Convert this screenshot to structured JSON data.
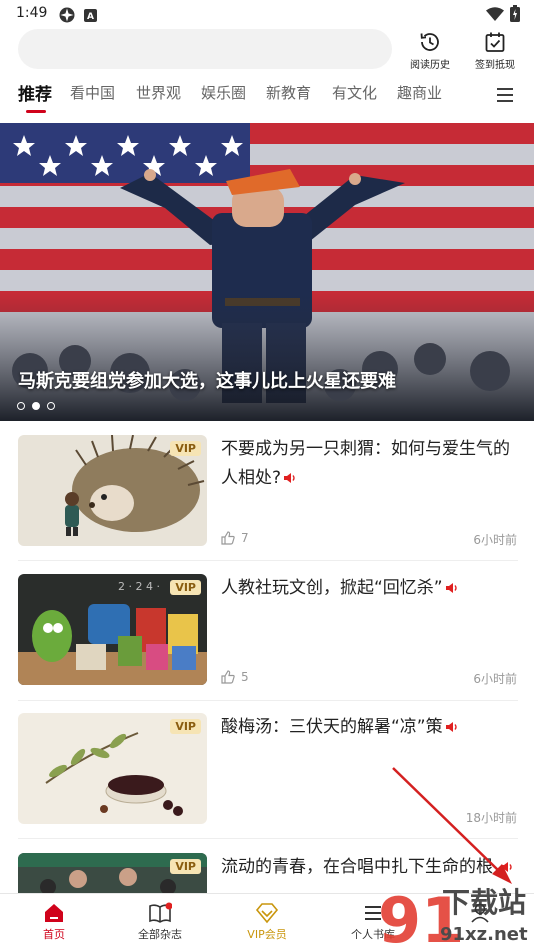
{
  "status_bar": {
    "time": "1:49"
  },
  "header": {
    "search_placeholder": "",
    "history_label": "阅读历史",
    "checkin_label": "签到抵现"
  },
  "tabs": [
    "推荐",
    "看中国",
    "世界观",
    "娱乐圈",
    "新教育",
    "有文化",
    "趣商业"
  ],
  "hero": {
    "title": "马斯克要组党参加大选，这事儿比上火星还要难",
    "slide_count": 3,
    "active_slide": 2
  },
  "articles": [
    {
      "title": "不要成为另一只刺猬：如何与爱生气的人相处?",
      "vip": "VIP",
      "likes": "7",
      "time": "6小时前"
    },
    {
      "title": "人教社玩文创，掀起“回忆杀”",
      "vip": "VIP",
      "likes": "5",
      "time": "6小时前"
    },
    {
      "title": "酸梅汤：三伏天的解暑“凉”策",
      "vip": "VIP",
      "likes": "",
      "time": "18小时前"
    },
    {
      "title": "流动的青春，在合唱中扎下生命的根",
      "vip": "VIP",
      "likes": "",
      "time": ""
    }
  ],
  "bottom_nav": [
    {
      "label": "首页"
    },
    {
      "label": "全部杂志"
    },
    {
      "label": "VIP会员"
    },
    {
      "label": "个人书库"
    },
    {
      "label": ""
    }
  ],
  "watermark": {
    "logo": "91",
    "text_top": "下载站",
    "text_bottom": "91xz.net"
  },
  "colors": {
    "accent": "#d0021b",
    "vip_gold": "#c9960d",
    "vip_tag_bg": "#f6e4b4",
    "annotation_arrow": "#d42020"
  }
}
